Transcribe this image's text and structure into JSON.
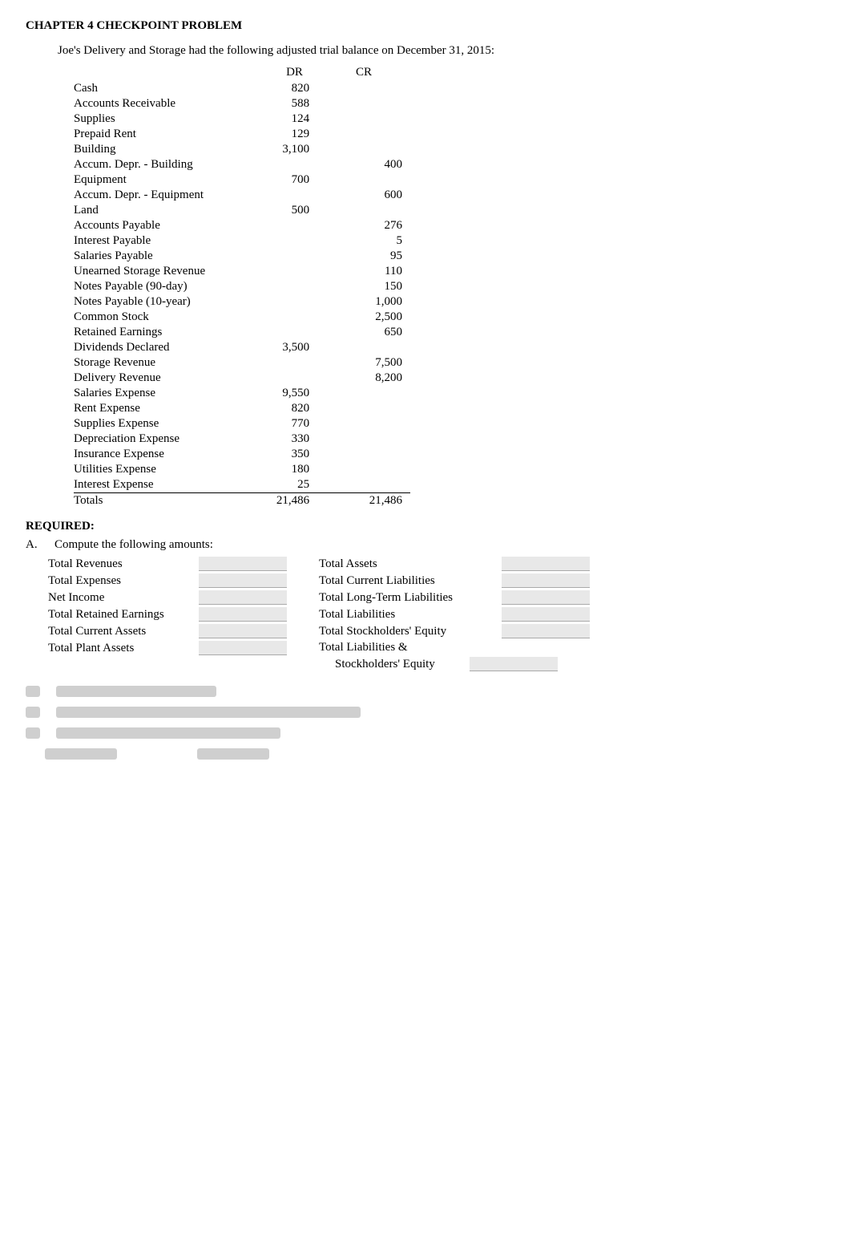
{
  "title": "CHAPTER 4 CHECKPOINT PROBLEM",
  "intro": "Joe's Delivery and Storage had the following adjusted trial balance on December 31, 2015:",
  "headers": {
    "dr": "DR",
    "cr": "CR"
  },
  "rows": [
    {
      "label": "Cash",
      "dr": "820",
      "cr": ""
    },
    {
      "label": "Accounts Receivable",
      "dr": "588",
      "cr": ""
    },
    {
      "label": "Supplies",
      "dr": "124",
      "cr": ""
    },
    {
      "label": "Prepaid Rent",
      "dr": "129",
      "cr": ""
    },
    {
      "label": "Building",
      "dr": "3,100",
      "cr": ""
    },
    {
      "label": "Accum. Depr. - Building",
      "dr": "",
      "cr": "400"
    },
    {
      "label": "Equipment",
      "dr": "700",
      "cr": ""
    },
    {
      "label": "Accum. Depr. - Equipment",
      "dr": "",
      "cr": "600"
    },
    {
      "label": "Land",
      "dr": "500",
      "cr": ""
    },
    {
      "label": "Accounts Payable",
      "dr": "",
      "cr": "276"
    },
    {
      "label": "Interest Payable",
      "dr": "",
      "cr": "5"
    },
    {
      "label": "Salaries Payable",
      "dr": "",
      "cr": "95"
    },
    {
      "label": "Unearned Storage Revenue",
      "dr": "",
      "cr": "110"
    },
    {
      "label": "Notes Payable (90-day)",
      "dr": "",
      "cr": "150"
    },
    {
      "label": "Notes Payable (10-year)",
      "dr": "",
      "cr": "1,000"
    },
    {
      "label": "Common Stock",
      "dr": "",
      "cr": "2,500"
    },
    {
      "label": "Retained Earnings",
      "dr": "",
      "cr": "650"
    },
    {
      "label": "Dividends Declared",
      "dr": "3,500",
      "cr": ""
    },
    {
      "label": "Storage Revenue",
      "dr": "",
      "cr": "7,500"
    },
    {
      "label": "Delivery Revenue",
      "dr": "",
      "cr": "8,200"
    },
    {
      "label": "Salaries Expense",
      "dr": "9,550",
      "cr": ""
    },
    {
      "label": "Rent Expense",
      "dr": "820",
      "cr": ""
    },
    {
      "label": "Supplies Expense",
      "dr": "770",
      "cr": ""
    },
    {
      "label": "Depreciation Expense",
      "dr": "330",
      "cr": ""
    },
    {
      "label": "Insurance Expense",
      "dr": "350",
      "cr": ""
    },
    {
      "label": "Utilities Expense",
      "dr": "180",
      "cr": ""
    },
    {
      "label": "Interest Expense",
      "dr": "25",
      "cr": ""
    },
    {
      "label": "Totals",
      "dr": "21,486",
      "cr": "21,486",
      "totals": true
    }
  ],
  "required_label": "REQUIRED:",
  "section_a_prefix": "A.",
  "section_a_intro": "Compute the following amounts:",
  "left_col": [
    {
      "label": "Total Revenues"
    },
    {
      "label": "Total Expenses"
    },
    {
      "label": "Net Income"
    },
    {
      "label": "Total Retained Earnings"
    },
    {
      "label": "Total Current Assets"
    },
    {
      "label": "Total Plant Assets"
    }
  ],
  "right_col": [
    {
      "label": "Total Assets"
    },
    {
      "label": "Total Current Liabilities"
    },
    {
      "label": "Total Long-Term Liabilities"
    },
    {
      "label": "Total Liabilities"
    },
    {
      "label": "Total Stockholders' Equity"
    },
    {
      "label": "Total Liabilities &"
    },
    {
      "label": "Stockholders' Equity"
    }
  ]
}
